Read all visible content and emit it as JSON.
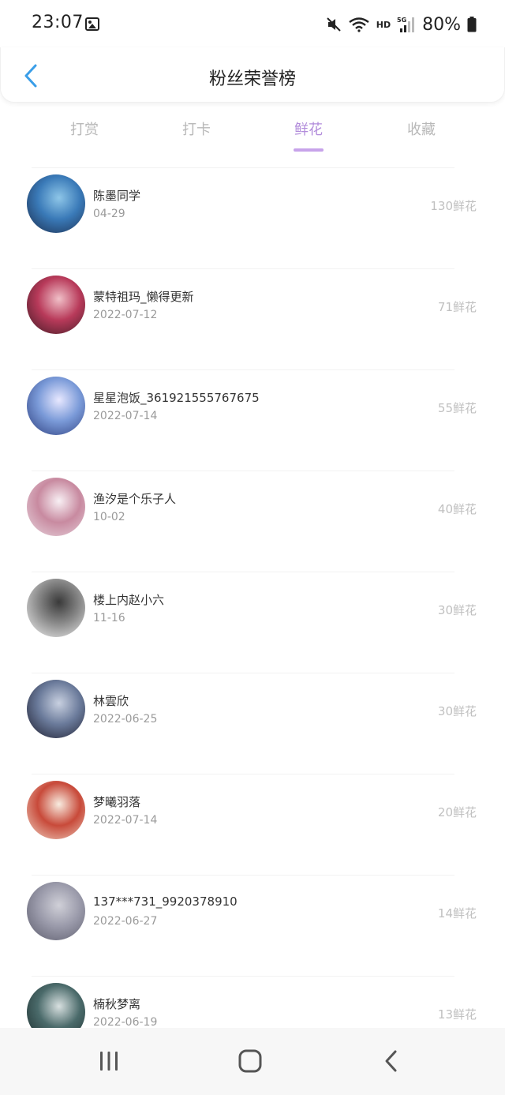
{
  "status": {
    "time": "23:07",
    "network_label": "HD",
    "battery": "80%"
  },
  "header": {
    "title": "粉丝荣誉榜"
  },
  "tabs": [
    {
      "label": "打赏",
      "active": false
    },
    {
      "label": "打卡",
      "active": false
    },
    {
      "label": "鲜花",
      "active": true
    },
    {
      "label": "收藏",
      "active": false
    }
  ],
  "fans": [
    {
      "name": "陈墨同学",
      "date": "04-29",
      "amount": "130鲜花",
      "avatar_colors": [
        "#1a2a4a",
        "#3a7ab8",
        "#8ec6e8"
      ]
    },
    {
      "name": "蒙特祖玛_懒得更新",
      "date": "2022-07-12",
      "amount": "71鲜花",
      "avatar_colors": [
        "#3a1a22",
        "#b83a5a",
        "#f0c0c8"
      ]
    },
    {
      "name": "星星泡饭_361921555767675",
      "date": "2022-07-14",
      "amount": "55鲜花",
      "avatar_colors": [
        "#2a3a7a",
        "#7a9ad8",
        "#e8e8ff"
      ]
    },
    {
      "name": "渔汐是个乐子人",
      "date": "10-02",
      "amount": "40鲜花",
      "avatar_colors": [
        "#e8d8e0",
        "#c88aa0",
        "#f8f0f4"
      ]
    },
    {
      "name": "楼上内赵小六",
      "date": "11-16",
      "amount": "30鲜花",
      "avatar_colors": [
        "#f4f4f4",
        "#8a8a8a",
        "#3a3a3a"
      ]
    },
    {
      "name": "林雲欣",
      "date": "2022-06-25",
      "amount": "30鲜花",
      "avatar_colors": [
        "#1a1a2a",
        "#6a7a9a",
        "#c8d0e0"
      ]
    },
    {
      "name": "梦曦羽落",
      "date": "2022-07-14",
      "amount": "20鲜花",
      "avatar_colors": [
        "#f0d8c8",
        "#c84a3a",
        "#f8ece0"
      ]
    },
    {
      "name": "137***731_9920378910",
      "date": "2022-06-27",
      "amount": "14鲜花",
      "avatar_colors": [
        "#5a5a6a",
        "#9a9aaa",
        "#d0d0d8"
      ]
    },
    {
      "name": "楠秋梦离",
      "date": "2022-06-19",
      "amount": "13鲜花",
      "avatar_colors": [
        "#1a2a2a",
        "#4a6a6a",
        "#d8e0e0"
      ]
    }
  ],
  "nav": {
    "recents_icon": "recents-icon",
    "home_icon": "home-icon",
    "back_icon": "back-icon"
  },
  "colors": {
    "accent": "#b28cdb",
    "back_arrow": "#3a9ee8",
    "muted": "#b8b8b8"
  }
}
